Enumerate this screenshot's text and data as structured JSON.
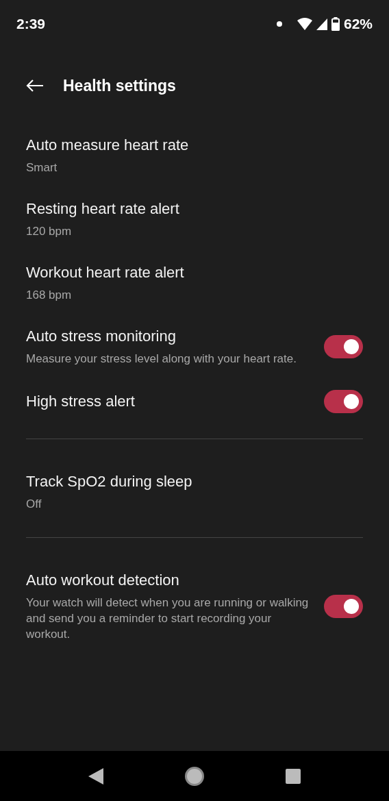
{
  "status_bar": {
    "time": "2:39",
    "battery": "62%"
  },
  "header": {
    "title": "Health settings"
  },
  "sections": [
    [
      {
        "kind": "value",
        "title": "Auto measure heart rate",
        "subtitle": "Smart"
      },
      {
        "kind": "value",
        "title": "Resting heart rate alert",
        "subtitle": "120 bpm"
      },
      {
        "kind": "value",
        "title": "Workout heart rate alert",
        "subtitle": "168 bpm"
      },
      {
        "kind": "toggle",
        "title": "Auto stress monitoring",
        "subtitle": "Measure your stress level along with your heart rate.",
        "on": true
      },
      {
        "kind": "toggle",
        "title": "High stress alert",
        "on": true
      }
    ],
    [
      {
        "kind": "value",
        "title": "Track SpO2 during sleep",
        "subtitle": "Off"
      }
    ],
    [
      {
        "kind": "toggle",
        "title": "Auto workout detection",
        "subtitle": "Your watch will detect when you are running or walking and send you a reminder to start recording your workout.",
        "on": true
      }
    ]
  ]
}
